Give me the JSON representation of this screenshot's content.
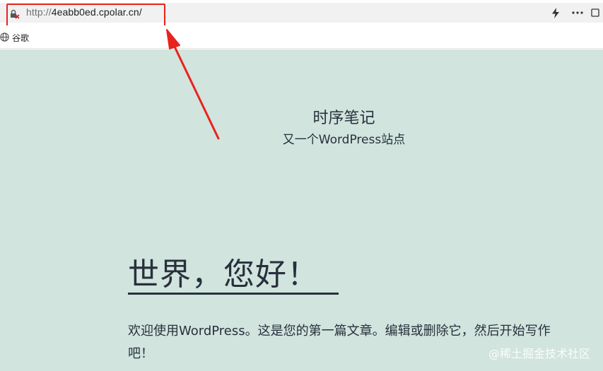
{
  "browser": {
    "url_protocol": "http://",
    "url_host": "4eabb0ed.cpolar.cn/",
    "bookmark_label": "谷歌",
    "icons": [
      "insecure-lock-icon",
      "bolt-icon",
      "more-icon",
      "globe-icon"
    ],
    "highlight_color": "#e8231e"
  },
  "site": {
    "title": "时序笔记",
    "description": "又一个WordPress站点"
  },
  "post": {
    "title": "世界，您好！",
    "excerpt": "欢迎使用WordPress。这是您的第一篇文章。编辑或删除它，然后开始写作吧！"
  },
  "watermark": "@稀土掘金技术社区",
  "colors": {
    "page_background": "#d1e4dd",
    "text": "#28303d"
  }
}
